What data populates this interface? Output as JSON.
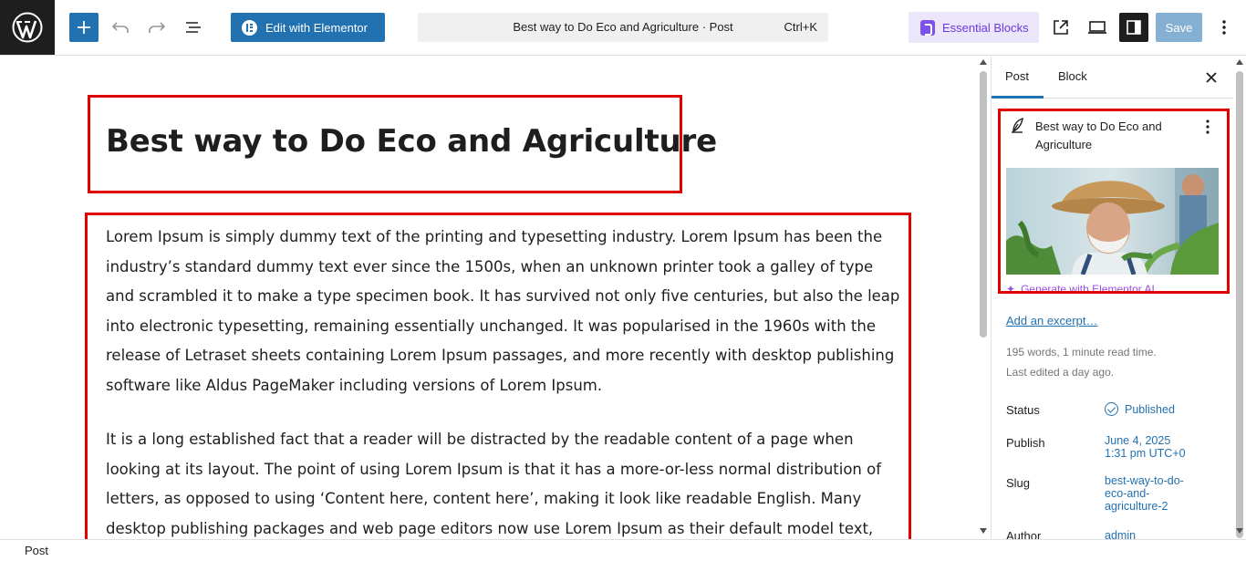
{
  "toolbar": {
    "add_block_icon": "plus-icon",
    "undo_icon": "undo-icon",
    "redo_icon": "redo-icon",
    "document_overview_icon": "list-view-icon",
    "elementor_button_label": "Edit with Elementor",
    "command_palette": {
      "title": "Best way to Do Eco and Agriculture · Post",
      "shortcut": "Ctrl+K"
    },
    "essential_blocks_label": "Essential Blocks",
    "view_post_icon": "external-link-icon",
    "device_preview_icon": "desktop-icon",
    "settings_icon": "sidebar-toggle-icon",
    "save_label": "Save",
    "options_icon": "more-vertical-icon"
  },
  "editor": {
    "post_title": "Best way to Do Eco and Agriculture",
    "paragraph1_lines": [
      "Lorem Ipsum is simply dummy text of the printing and typesetting industry. Lorem Ipsum has been the",
      "industry’s standard dummy text ever since the 1500s, when an unknown printer took a galley of type",
      "and scrambled it to make a type specimen book. It has survived not only five centuries, but also the leap",
      "into electronic typesetting, remaining essentially unchanged. It was popularised in the 1960s with the",
      "release of Letraset sheets containing Lorem Ipsum passages, and more recently with desktop publishing",
      "software like Aldus PageMaker including versions of Lorem Ipsum."
    ],
    "paragraph2_lines": [
      "It is a long established fact that a reader will be distracted by the readable content of a page when",
      "looking at its layout. The point of using Lorem Ipsum is that it has a more-or-less normal distribution of",
      "letters, as opposed to using ‘Content here, content here’, making it look like readable English. Many",
      "desktop publishing packages and web page editors now use Lorem Ipsum as their default model text,"
    ]
  },
  "footer": {
    "breadcrumb": "Post"
  },
  "sidebar": {
    "tabs": [
      {
        "label": "Post",
        "active": true
      },
      {
        "label": "Block",
        "active": false
      }
    ],
    "summary_title": "Best way to Do Eco and Agriculture",
    "generate_ai_label": "Generate with Elementor AI",
    "excerpt_link": "Add an excerpt…",
    "word_count": "195 words, 1 minute read time.",
    "last_edited": "Last edited a day ago.",
    "status": {
      "label": "Status",
      "value": "Published"
    },
    "publish": {
      "label": "Publish",
      "value_line1": "June 4, 2025",
      "value_line2": "1:31 pm UTC+0"
    },
    "slug": {
      "label": "Slug",
      "value_lines": [
        "best-way-to-do-",
        "eco-and-",
        "agriculture-2"
      ]
    },
    "author": {
      "label": "Author",
      "value": "admin"
    }
  },
  "colors": {
    "accent": "#2271b1",
    "highlight_box": "#e00000",
    "essential_blocks": "#6c38e5",
    "ai_purple": "#9b51e0"
  }
}
